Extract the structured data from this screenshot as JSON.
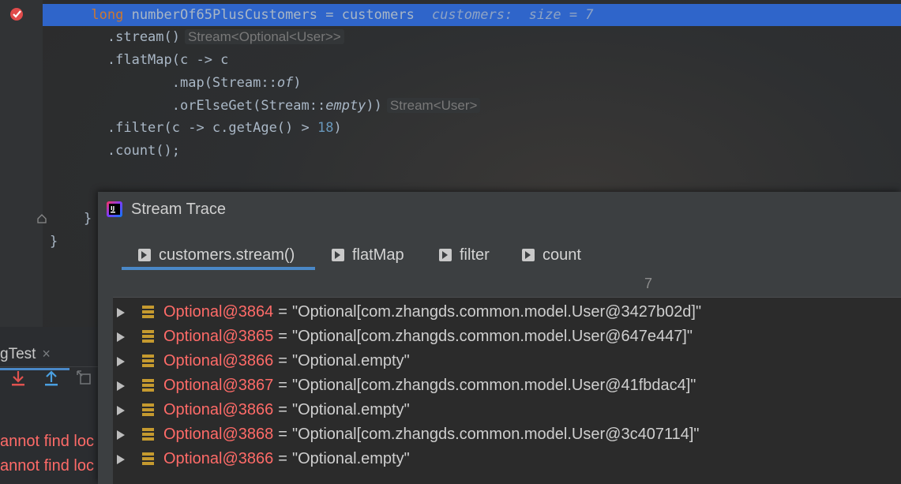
{
  "editor": {
    "lines": [
      {
        "prefix": "",
        "kw": "long",
        "text": " numberOf65PlusCustomers = customers",
        "debug": "customers:  size = 7",
        "hint": ""
      },
      {
        "text": "        .stream()",
        "hint": "Stream<Optional<User>>"
      },
      {
        "text": "        .flatMap(c -> c"
      },
      {
        "text_a": "                .map(Stream::",
        "ital": "of",
        "text_b": ")"
      },
      {
        "text_a": "                .orElseGet(Stream::",
        "ital": "empty",
        "text_b": "))",
        "hint": "Stream<User>"
      },
      {
        "text_a": "        .filter(c -> c.getAge() > ",
        "num": "18",
        "text_b": ")"
      },
      {
        "text": "        .count();"
      }
    ],
    "close_brace_1": "}",
    "close_brace_2": "}"
  },
  "run_panel": {
    "tab_label": "gTest",
    "tab_close": "×",
    "console_lines": [
      "annot find loc",
      "annot find loc"
    ]
  },
  "dialog": {
    "title": "Stream Trace",
    "tabs": [
      "customers.stream()",
      "flatMap",
      "filter",
      "count"
    ],
    "selected_tab": "customers.stream()",
    "count": "7",
    "rows": [
      {
        "obj": "Optional@3864",
        "value": "\"Optional[com.zhangds.common.model.User@3427b02d]\""
      },
      {
        "obj": "Optional@3865",
        "value": "\"Optional[com.zhangds.common.model.User@647e447]\""
      },
      {
        "obj": "Optional@3866",
        "value": "\"Optional.empty\""
      },
      {
        "obj": "Optional@3867",
        "value": "\"Optional[com.zhangds.common.model.User@41fbdac4]\""
      },
      {
        "obj": "Optional@3866",
        "value": "\"Optional.empty\""
      },
      {
        "obj": "Optional@3868",
        "value": "\"Optional[com.zhangds.common.model.User@3c407114]\""
      },
      {
        "obj": "Optional@3866",
        "value": "\"Optional.empty\""
      }
    ]
  },
  "colors": {
    "current_line": "#2f65ca",
    "keyword": "#cc7832",
    "number": "#6897bb",
    "object_ref": "#ff6b68",
    "tab_underline": "#4a88c7"
  }
}
